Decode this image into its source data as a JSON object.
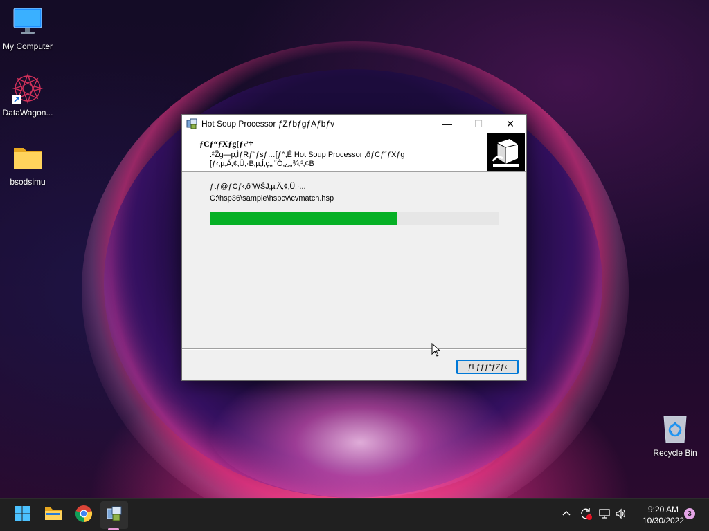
{
  "desktop": {
    "icons": [
      {
        "label": "My Computer",
        "icon": "monitor-icon"
      },
      {
        "label": "DataWagon...",
        "icon": "datawagon-shortcut-icon"
      },
      {
        "label": "bsodsimu",
        "icon": "folder-icon"
      },
      {
        "label": "Recycle Bin",
        "icon": "recycle-bin-icon"
      }
    ]
  },
  "dialog": {
    "title": "Hot Soup Processor ƒZƒbƒgƒAƒbƒv",
    "header_title": "ƒCƒ“ƒXƒg[ƒ‹’†",
    "header_subtitle_line1": ".²Žg—p‚ÌƒRƒ“ƒsƒ…[ƒ^‚É Hot Soup Processor ‚ðƒCƒ“ƒXƒg",
    "header_subtitle_line2": "[ƒ‹‚µ‚Ä‚¢‚Ü‚·B‚µ‚Î‚ç‚­‚¨‘Ò‚¿‚­‚¾‚³‚¢B",
    "status_text": "ƒtƒ@ƒCƒ‹‚ð“WŠJ‚µ‚Ä‚¢‚Ü‚·...",
    "file_path": "C:\\hsp36\\sample\\hspcv\\cvmatch.hsp",
    "progress_fraction": 0.65,
    "cancel_label": "ƒLƒƒƒ“ƒZƒ‹",
    "minimize_glyph": "—",
    "maximize_glyph": "☐",
    "close_glyph": "✕"
  },
  "taskbar": {
    "items": [
      {
        "name": "start-button",
        "icon": "windows-logo-icon"
      },
      {
        "name": "file-explorer",
        "icon": "folder-icon"
      },
      {
        "name": "chrome",
        "icon": "chrome-icon"
      },
      {
        "name": "hsp-setup",
        "icon": "hsp-setup-icon",
        "active": true
      }
    ],
    "tray_icons": [
      "chevron-up-icon",
      "sync-icon",
      "network-icon",
      "volume-icon"
    ],
    "time": "9:20 AM",
    "date": "10/30/2022",
    "notification_count": "3"
  },
  "colors": {
    "progress": "#06b025",
    "accent": "#0078d7"
  }
}
